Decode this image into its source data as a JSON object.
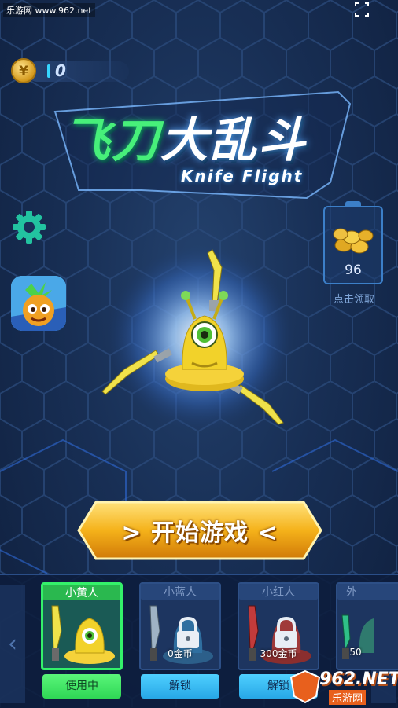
{
  "watermark": "乐游网 www.962.net",
  "coins": {
    "symbol": "¥",
    "value": "0"
  },
  "logo": {
    "title_green": "飞刀",
    "title_white": "大乱斗",
    "subtitle": "Knife Flight"
  },
  "gift": {
    "value": "96",
    "label": "点击领取"
  },
  "start_button": {
    "label": "> 开始游戏 <"
  },
  "shop": {
    "characters": [
      {
        "name": "小黄人",
        "price": "",
        "action": "使用中",
        "status": "active",
        "body_color": "#f2d22a",
        "blade_color": "#f0e24a"
      },
      {
        "name": "小蓝人",
        "price": "0金币",
        "action": "解锁",
        "status": "locked",
        "body_color": "#2f6fa0",
        "blade_color": "#9fb3c4"
      },
      {
        "name": "小红人",
        "price": "300金币",
        "action": "解锁",
        "status": "locked",
        "body_color": "#a03a3a",
        "blade_color": "#c23b3b"
      },
      {
        "name": "外",
        "price": "50",
        "action": "",
        "status": "locked",
        "body_color": "#2f7a6e",
        "blade_color": "#2fbf88"
      }
    ],
    "left_arrow": "‹",
    "right_arrow": "›"
  },
  "brand": {
    "main": "962.NET",
    "sub": "乐游网"
  },
  "colors": {
    "accent_green": "#34f16a",
    "accent_blue": "#36d6ff",
    "gold": "#f5b21a"
  }
}
